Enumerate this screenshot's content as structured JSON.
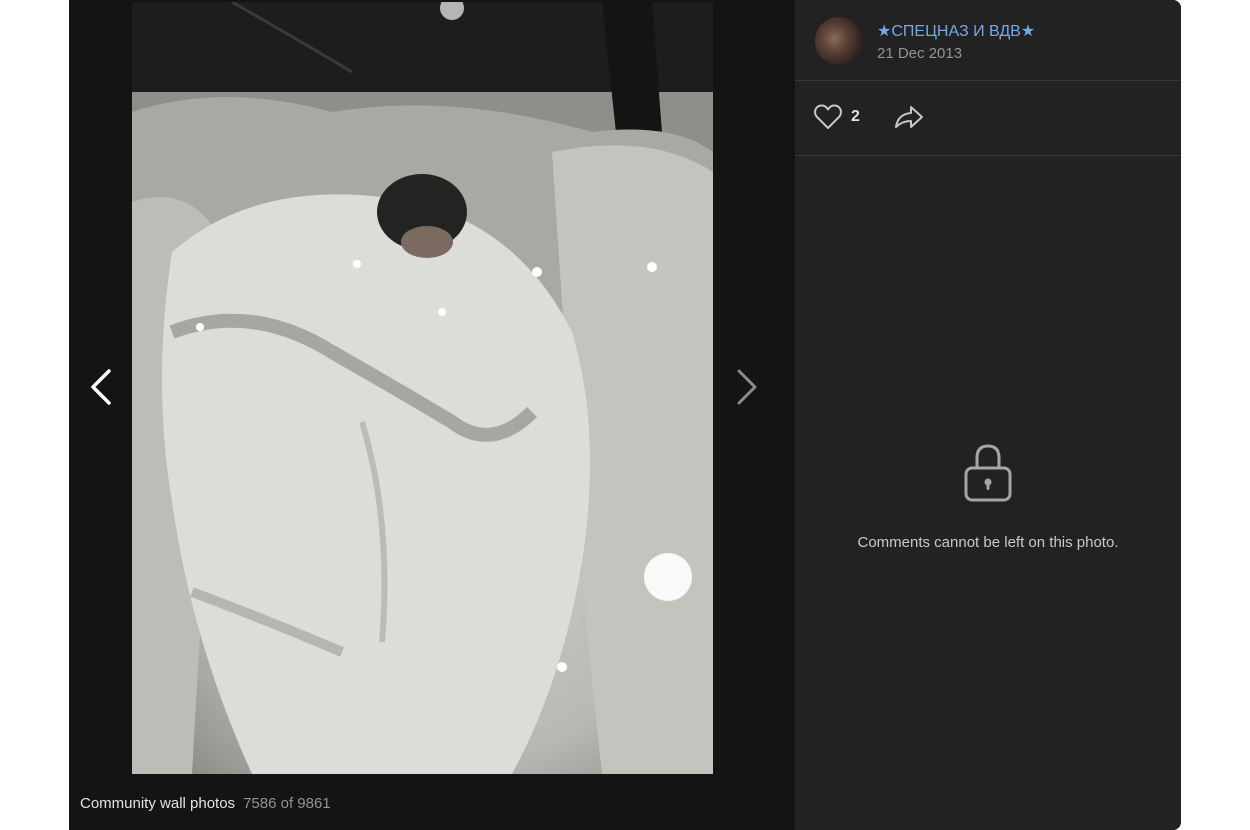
{
  "author": {
    "name": "★СПЕЦНАЗ И ВДВ★",
    "date": "21 Dec 2013"
  },
  "actions": {
    "like_count": "2"
  },
  "comments": {
    "locked_message": "Comments cannot be left on this photo."
  },
  "caption": {
    "album": "Community wall photos",
    "counter": "7586 of 9861"
  },
  "icons": {
    "prev": "chevron-left-icon",
    "next": "chevron-right-icon",
    "like": "heart-icon",
    "share": "share-arrow-icon",
    "lock": "lock-icon"
  },
  "colors": {
    "link": "#71aaeb",
    "panel": "#222222",
    "background": "#141414"
  }
}
